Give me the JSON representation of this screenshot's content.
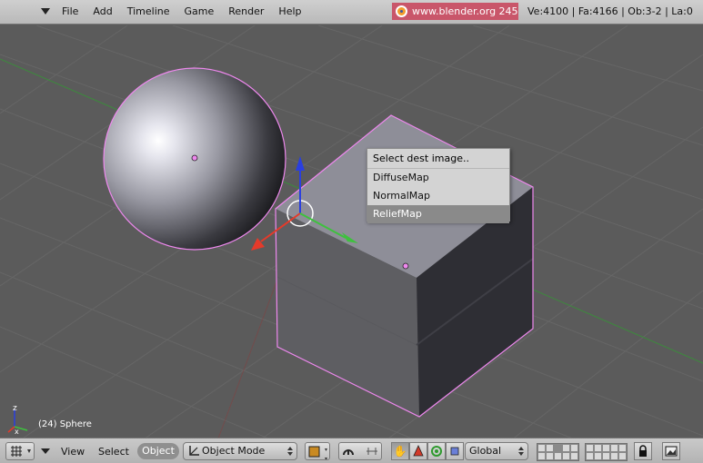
{
  "header": {
    "menu": [
      "File",
      "Add",
      "Timeline",
      "Game",
      "Render",
      "Help"
    ],
    "website": "www.blender.org 245",
    "stats": "Ve:4100 | Fa:4166 | Ob:3-2 | La:0"
  },
  "viewport": {
    "object_info": "(24) Sphere",
    "axis_labels": {
      "z": "z",
      "x": "x"
    }
  },
  "popup": {
    "title": "Select dest image..",
    "items": [
      "DiffuseMap",
      "NormalMap",
      "ReliefMap"
    ],
    "selected": "ReliefMap"
  },
  "footer": {
    "view": "View",
    "select": "Select",
    "object": "Object",
    "mode": "Object Mode",
    "orientation": "Global"
  },
  "colors": {
    "selection_outline": "#ee88ee",
    "menu_highlight": "#8a8a8a",
    "website_bg": "#c9566a",
    "axis_x": "#e53a2a",
    "axis_y": "#3ec13e",
    "axis_z": "#2a3fe0"
  },
  "icons": {
    "editor_type": "grid-icon",
    "website": "blender-logo-icon",
    "manipulator": "hand-icon",
    "draw_type": "cube-icon",
    "pivot": "pivot-icon",
    "snap": "magnet-icon",
    "lock": "lock-icon",
    "render": "image-icon"
  }
}
